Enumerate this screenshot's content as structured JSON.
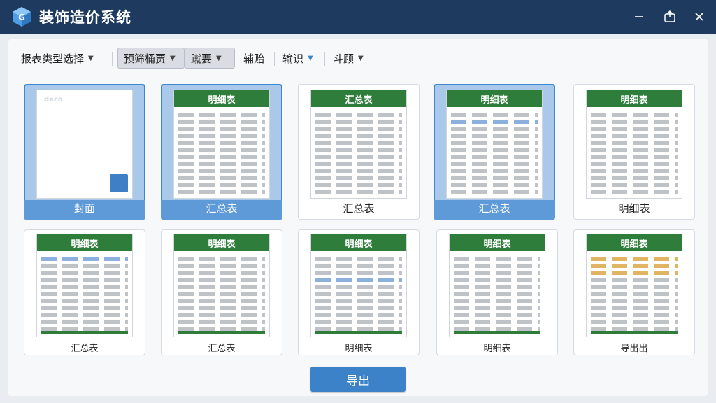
{
  "window": {
    "title": "装饰造价系统",
    "accent": "#1e3a5f"
  },
  "toolbar": {
    "items": [
      {
        "label": "报表类型选择",
        "has_dropdown": true,
        "active": false
      },
      {
        "label": "预筛桶贾",
        "has_dropdown": true,
        "active": true
      },
      {
        "label": "蹴要",
        "has_dropdown": true,
        "active": true
      },
      {
        "label": "辅贻",
        "has_dropdown": false,
        "active": false
      },
      {
        "label": "输识",
        "has_dropdown": true,
        "active": false
      },
      {
        "label": "斗顾",
        "has_dropdown": true,
        "active": false
      }
    ]
  },
  "cards": [
    {
      "thumb_title": "封面",
      "caption": "封面",
      "kind": "cover",
      "selected": true,
      "cover_brand": "deco"
    },
    {
      "thumb_title": "明细表",
      "caption": "汇总表",
      "kind": "table",
      "selected": true
    },
    {
      "thumb_title": "汇总表",
      "caption": "汇总表",
      "kind": "table",
      "selected": false
    },
    {
      "thumb_title": "明细表",
      "caption": "汇总表",
      "kind": "table",
      "selected": true
    },
    {
      "thumb_title": "明细表",
      "caption": "明细表",
      "kind": "table",
      "selected": false
    },
    {
      "thumb_title": "明细表",
      "caption": "汇总表",
      "kind": "table",
      "selected": false
    },
    {
      "thumb_title": "明细表",
      "caption": "汇总表",
      "kind": "table",
      "selected": false
    },
    {
      "thumb_title": "明细表",
      "caption": "明细表",
      "kind": "table",
      "selected": false
    },
    {
      "thumb_title": "明细表",
      "caption": "明细表",
      "kind": "table",
      "selected": false
    },
    {
      "thumb_title": "明细表",
      "caption": "导出出",
      "kind": "table",
      "selected": false
    }
  ],
  "export_button": {
    "label": "导出"
  },
  "colors": {
    "selected_bg": "#a9c8ea",
    "selected_border": "#3f87d0",
    "sheet_header": "#2f7d3a",
    "export_button": "#3c82c9"
  }
}
